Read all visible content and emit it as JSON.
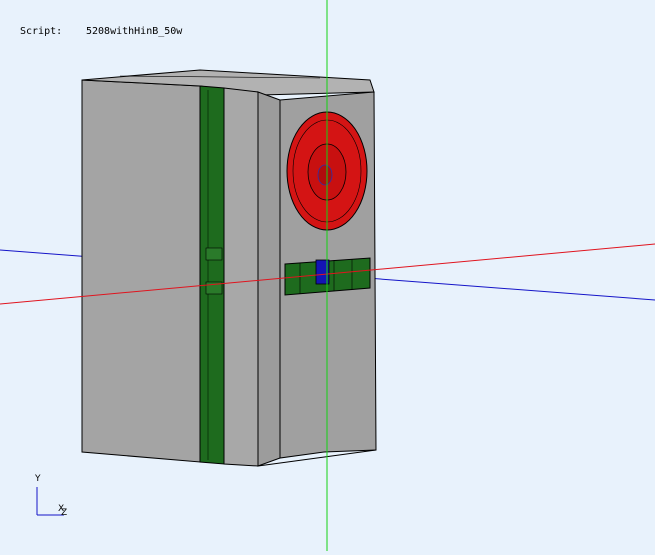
{
  "header": {
    "script_label": "Script:",
    "script_name": "5208withHinB_50w"
  },
  "triad": {
    "y_label": "Y",
    "x_label": "X",
    "z_label": "Z"
  },
  "colors": {
    "background": "#e8f2fc",
    "body_gray": "#a3a3a3",
    "green_strip": "#1e6b1e",
    "red_speaker": "#d41414",
    "blue_part": "#1414b4",
    "axis_red": "#e0141e",
    "axis_green": "#14d214",
    "axis_blue": "#1414c8"
  },
  "scene": {
    "object_name": "5208withHinB_50w"
  }
}
